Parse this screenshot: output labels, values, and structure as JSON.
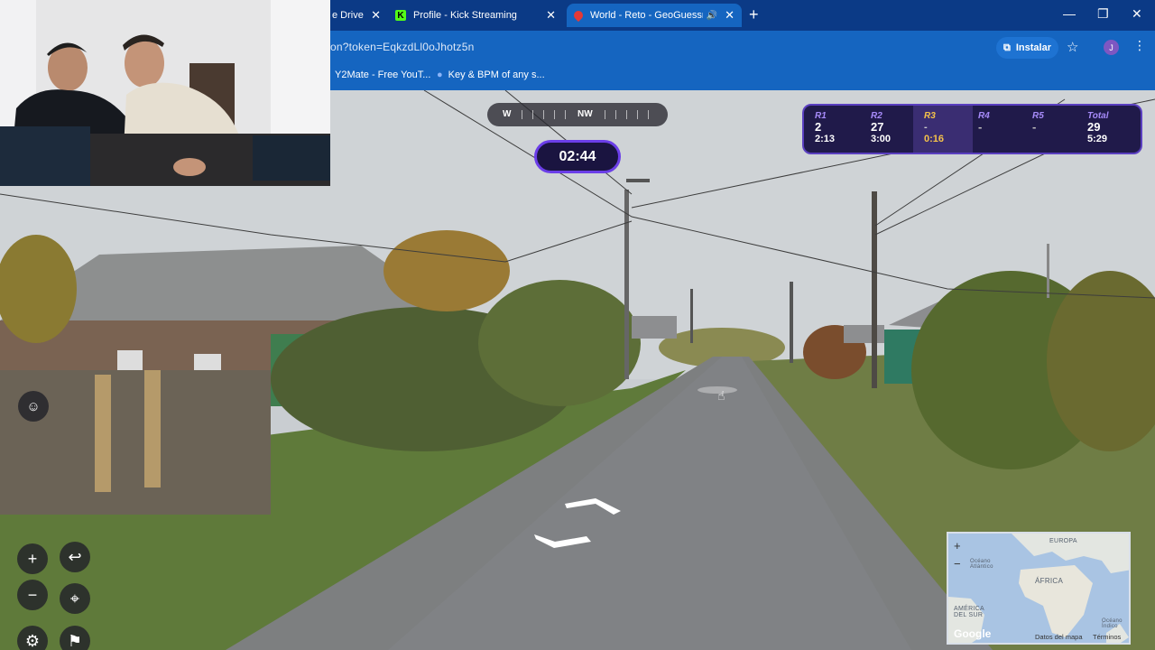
{
  "browser": {
    "tabs": [
      {
        "title": "e Drive",
        "close": "✕"
      },
      {
        "title": "Profile - Kick Streaming",
        "close": "✕",
        "favicon": "K"
      },
      {
        "title": "World - Reto - GeoGuessr",
        "close": "✕",
        "active": true,
        "audio": "🔊"
      }
    ],
    "new_tab": "+",
    "window_controls": {
      "minimize": "—",
      "restore": "❐",
      "close": "✕"
    },
    "url": "on?token=EqkzdLl0oJhotz5n",
    "install_label": "Instalar",
    "profile_initial": "J",
    "bookmarks": [
      {
        "label": "Y2Mate - Free YouT..."
      },
      {
        "label": "Key & BPM of any s..."
      }
    ],
    "colors": {
      "tabbar": "#0b3a86",
      "toolbar": "#1565c0"
    }
  },
  "hud": {
    "compass": {
      "labels": [
        "W",
        "NW"
      ]
    },
    "timer": "02:44",
    "rounds": [
      {
        "name": "R1",
        "score": "2",
        "time": "2:13"
      },
      {
        "name": "R2",
        "score": "27",
        "time": "3:00"
      },
      {
        "name": "R3",
        "score": "-",
        "time": "0:16",
        "current": true
      },
      {
        "name": "R4",
        "score": "-",
        "time": ""
      },
      {
        "name": "R5",
        "score": "-",
        "time": ""
      },
      {
        "name": "Total",
        "score": "29",
        "time": "5:29"
      }
    ],
    "controls": {
      "zoom_in": "+",
      "zoom_out": "−",
      "undo": "↩",
      "checkpoint": "⌖",
      "settings": "⚙",
      "flag": "⚑"
    }
  },
  "minimap": {
    "labels": {
      "europe": "EUROPA",
      "africa": "ÁFRICA",
      "south_america": "AMÉRICA DEL SUR",
      "ocean": "Océano Atlántico",
      "ocean2": "Océano Índico"
    },
    "zoom_in": "+",
    "zoom_out": "−",
    "brand": "Google",
    "footer": [
      "Datos del mapa",
      "Términos"
    ]
  }
}
